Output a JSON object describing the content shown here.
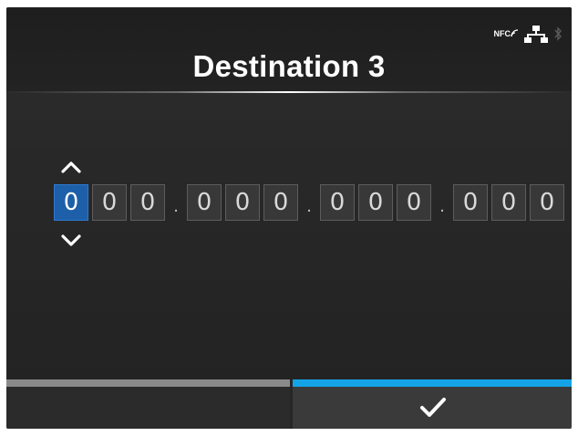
{
  "header": {
    "title": "Destination 3",
    "status": {
      "nfc_label": "NFC",
      "icons": [
        "nfc-icon",
        "wired-network-icon",
        "bluetooth-icon"
      ]
    }
  },
  "ip_editor": {
    "selected_index": 0,
    "octets": [
      [
        "0",
        "0",
        "0"
      ],
      [
        "0",
        "0",
        "0"
      ],
      [
        "0",
        "0",
        "0"
      ],
      [
        "0",
        "0",
        "0"
      ]
    ],
    "separator": ".",
    "icons": {
      "increment": "chevron-up-icon",
      "decrement": "chevron-down-icon"
    }
  },
  "footer": {
    "left_button": {
      "icon": "none"
    },
    "right_button": {
      "icon": "checkmark-icon"
    }
  },
  "colors": {
    "background": "#262626",
    "selected_digit": "#1d5fa8",
    "accent_bar": "#15a3e8",
    "inactive_bar": "#8a8a8a"
  }
}
